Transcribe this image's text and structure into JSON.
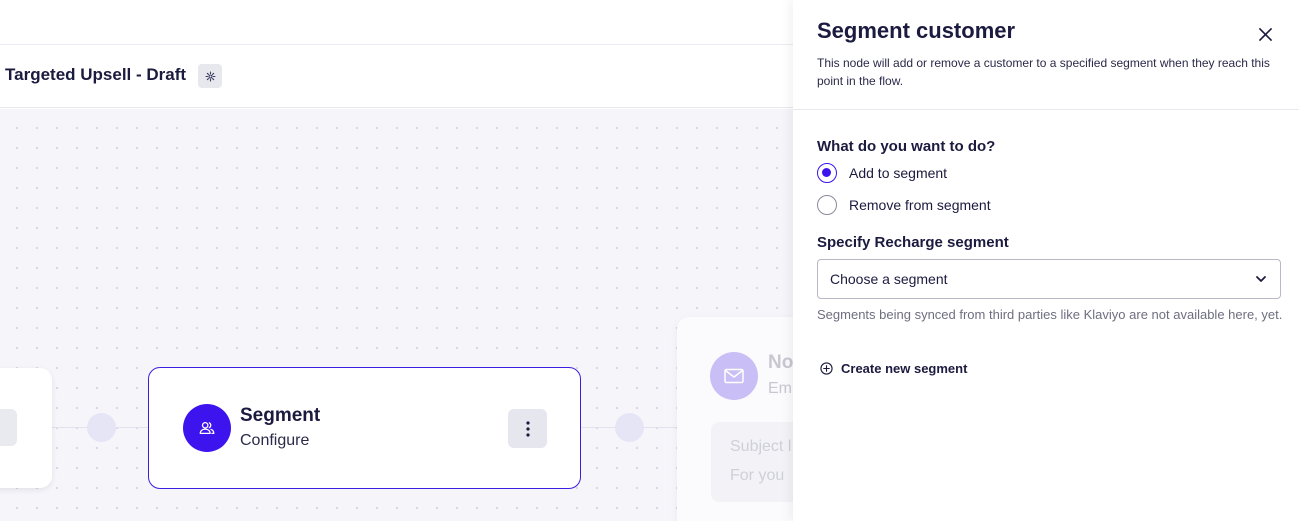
{
  "flow": {
    "title": "Targeted Upsell - Draft"
  },
  "canvas": {
    "segment_node": {
      "title": "Segment",
      "subtitle": "Configure"
    },
    "next_node": {
      "title": "No",
      "subtitle": "Em",
      "preview_line1": "Subject l",
      "preview_line2": "For you"
    }
  },
  "panel": {
    "title": "Segment customer",
    "description": "This node will add or remove a customer to a specified segment when they reach this point in the flow.",
    "question": "What do you want to do?",
    "options": [
      {
        "label": "Add to segment",
        "selected": true
      },
      {
        "label": "Remove from segment",
        "selected": false
      }
    ],
    "segment_label": "Specify Recharge segment",
    "segment_select": {
      "value": "Choose a segment"
    },
    "helper": "Segments being synced from third parties like Klaviyo are not available here, yet.",
    "create_link": "Create new segment"
  },
  "colors": {
    "accent": "#3d14ee",
    "text": "#1b1a3f",
    "muted": "#6f6e80",
    "canvas_bg": "#f6f5fa"
  },
  "icons": {
    "settings": "gear-icon",
    "segment": "users-icon",
    "menu": "kebab-icon",
    "email": "mail-icon",
    "close": "close-icon",
    "dropdown": "chevron-down-icon",
    "create": "plus-circle-icon"
  }
}
